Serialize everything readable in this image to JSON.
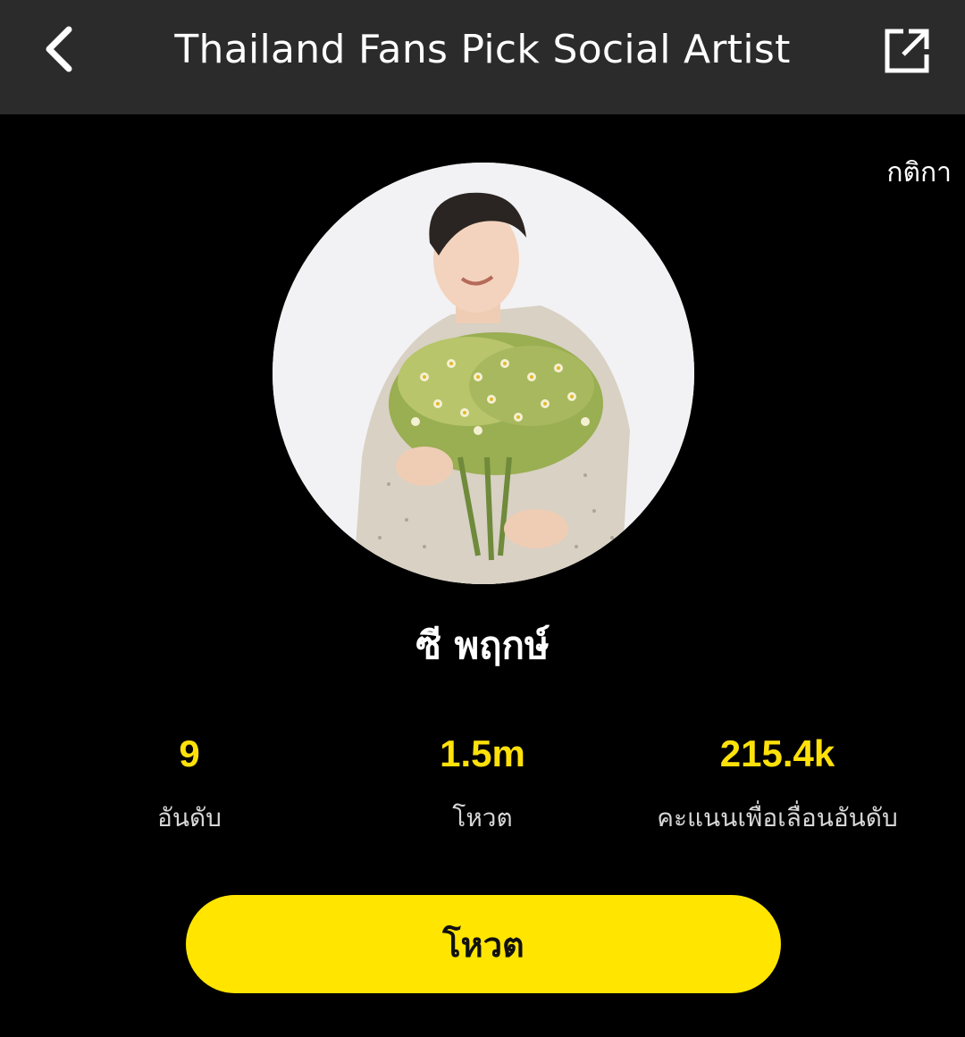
{
  "header": {
    "title": "Thailand Fans Pick Social Artist",
    "back_icon": "chevron-left-icon",
    "share_icon": "external-link-icon"
  },
  "rules_link": "กติกา",
  "artist": {
    "name": "ซี พฤกษ์"
  },
  "stats": [
    {
      "value": "9",
      "label": "อันดับ"
    },
    {
      "value": "1.5m",
      "label": "โหวต"
    },
    {
      "value": "215.4k",
      "label": "คะแนนเพื่อเลื่อนอันดับ"
    }
  ],
  "vote_button": "โหวต",
  "colors": {
    "background": "#000000",
    "header_bg": "#2b2b2b",
    "accent_yellow": "#ffe500",
    "stat_value": "#ffe10a"
  }
}
